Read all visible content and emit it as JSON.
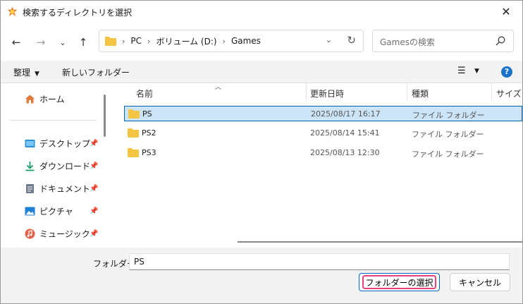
{
  "window": {
    "title": "検索するディレクトリを選択"
  },
  "address": {
    "breadcrumbs": [
      "PC",
      "ボリューム (D:)",
      "Games"
    ]
  },
  "search": {
    "placeholder": "Gamesの検索"
  },
  "toolbar": {
    "organize_label": "整理",
    "new_folder_label": "新しいフォルダー"
  },
  "nav_pane": {
    "items": [
      {
        "label": "ホーム",
        "icon": "home-icon"
      },
      {
        "label": "デスクトップ",
        "icon": "desktop-icon"
      },
      {
        "label": "ダウンロード",
        "icon": "download-icon"
      },
      {
        "label": "ドキュメント",
        "icon": "document-icon"
      },
      {
        "label": "ピクチャ",
        "icon": "pictures-icon"
      },
      {
        "label": "ミュージック",
        "icon": "music-icon"
      }
    ]
  },
  "file_list": {
    "columns": {
      "name": "名前",
      "modified": "更新日時",
      "type": "種類",
      "size": "サイズ"
    },
    "rows": [
      {
        "name": "PS",
        "modified": "2025/08/17 16:17",
        "type": "ファイル フォルダー",
        "selected": true
      },
      {
        "name": "PS2",
        "modified": "2025/08/14 15:41",
        "type": "ファイル フォルダー",
        "selected": false
      },
      {
        "name": "PS3",
        "modified": "2025/08/13 12:30",
        "type": "ファイル フォルダー",
        "selected": false
      }
    ]
  },
  "footer": {
    "folder_label": "フォルダー:",
    "folder_value": "PS",
    "select_button": "フォルダーの選択",
    "cancel_button": "キャンセル"
  },
  "colors": {
    "accent": "#0067c0",
    "highlight": "#e8407a",
    "selection": "#cce4f7",
    "folder": "#f4c542"
  }
}
